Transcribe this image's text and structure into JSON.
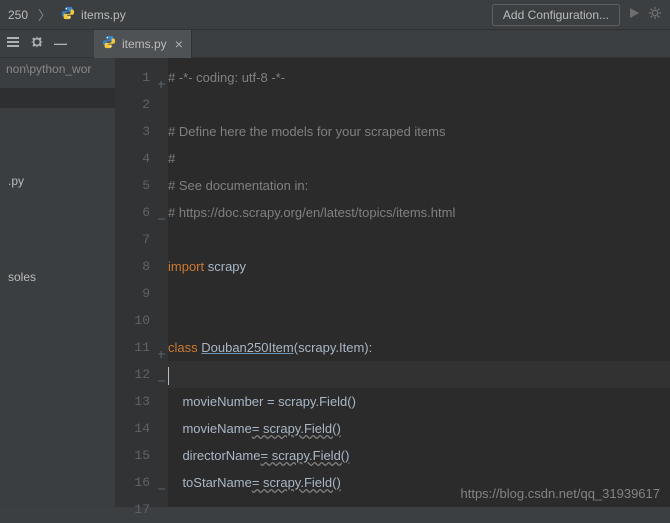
{
  "top": {
    "crumb1": "250",
    "crumb2": "items.py",
    "add_config": "Add Configuration..."
  },
  "tab": {
    "label": "items.py"
  },
  "sidebar": {
    "path": "non\\python_wor",
    "item1": ".py",
    "item2": "soles"
  },
  "gutter": {
    "lines": [
      "1",
      "2",
      "3",
      "4",
      "5",
      "6",
      "7",
      "8",
      "9",
      "10",
      "11",
      "12",
      "13",
      "14",
      "15",
      "16",
      "17"
    ]
  },
  "code": {
    "l1": "# -*- coding: utf-8 -*-",
    "l3": "# Define here the models for your scraped items",
    "l4": "#",
    "l5": "# See documentation in:",
    "l6": "# https://doc.scrapy.org/en/latest/topics/items.html",
    "l8_kw": "import ",
    "l8_mod": "scrapy",
    "l11_kw": "class ",
    "l11_name": "Douban250Item",
    "l11_rest": "(scrapy.Item):",
    "l13": "    movieNumber = scrapy.Field()",
    "l14a": "    movieName",
    "l14b": "= scrapy.Field()",
    "l15a": "    directorName",
    "l15b": "= scrapy.Field()",
    "l16a": "    toStarName",
    "l16b": "= scrapy.Field()"
  },
  "watermark": "https://blog.csdn.net/qq_31939617"
}
